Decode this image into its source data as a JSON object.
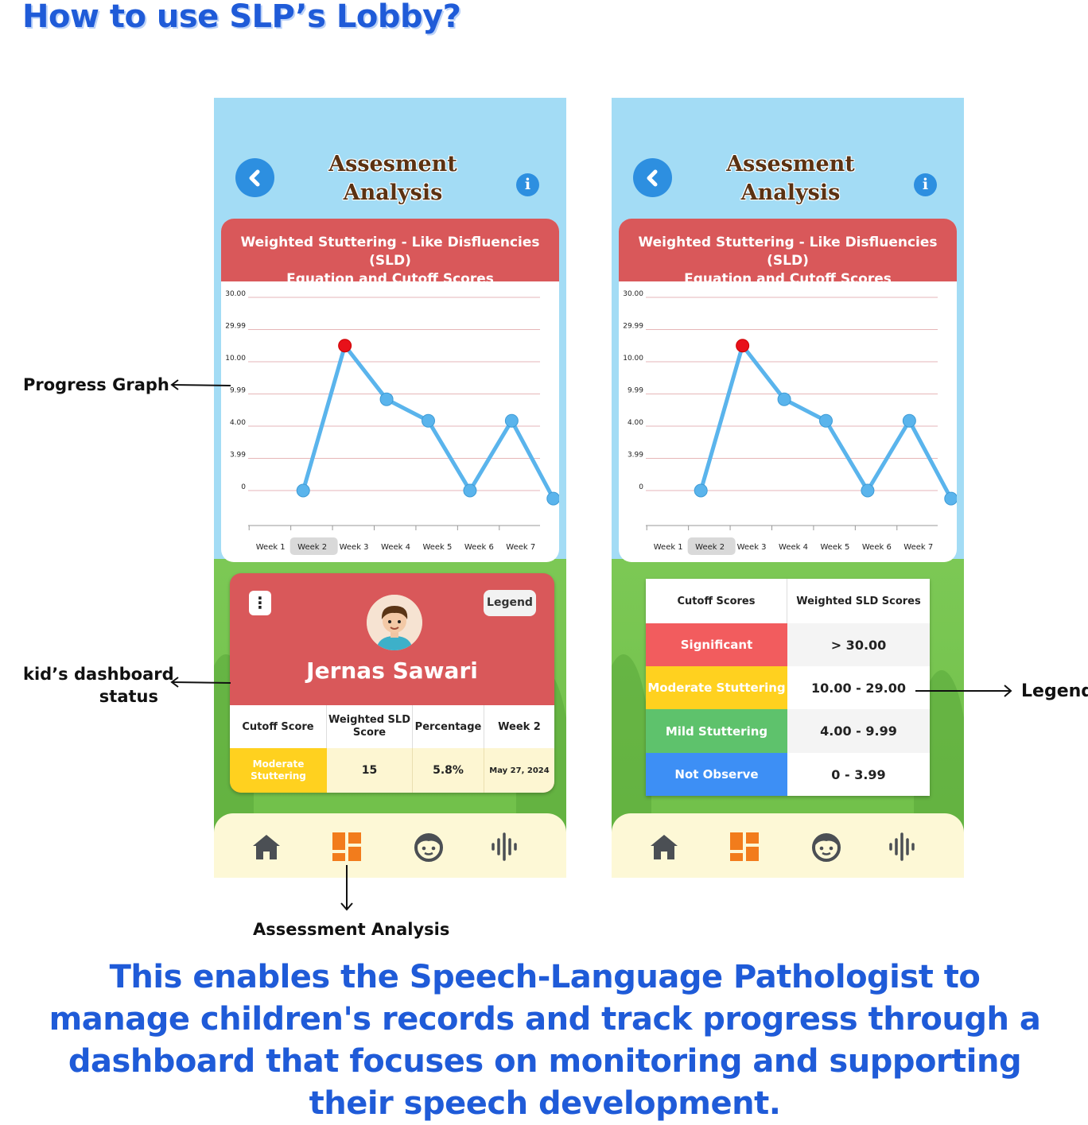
{
  "page_title": "How to use SLP’s Lobby?",
  "screen": {
    "title_line1": "Assesment",
    "title_line2": "Analysis",
    "back_icon": "chevron-left-icon",
    "info_icon": "info-icon",
    "info_glyph": "i"
  },
  "chart_card": {
    "header_line1": "Weighted Stuttering - Like Disfluencies (SLD)",
    "header_line2": "Equation and Cutoff Scores"
  },
  "chart_data": {
    "type": "line",
    "y_tick_labels": [
      "30.00",
      "29.99",
      "10.00",
      "9.99",
      "4.00",
      "3.99",
      "0"
    ],
    "categories": [
      "Week 1",
      "Week 2",
      "Week 3",
      "Week 4",
      "Week 5",
      "Week 6",
      "Week 7"
    ],
    "highlighted_category": "Week 2",
    "series": [
      {
        "values": [
          0,
          20,
          9,
          5,
          0,
          5,
          -1
        ]
      }
    ],
    "highlighted_point_index": 1,
    "colors": {
      "line": "#5ab4ec",
      "point": "#5ab4ec",
      "highlight_point": "#e8111a",
      "grid": "#e6b6b8"
    },
    "grid": true
  },
  "kid_card": {
    "menu_glyph": "⋮",
    "legend_button": "Legend",
    "avatar_icon": "kid-avatar-icon",
    "name": "Jernas Sawari",
    "headers": [
      "Cutoff Score",
      "Weighted SLD Score",
      "Percentage",
      "Week 2"
    ],
    "row": {
      "cutoff": "Moderate Stuttering",
      "score": "15",
      "percentage": "5.8%",
      "date": "May 27, 2024"
    }
  },
  "legend_table": {
    "headers": [
      "Cutoff Scores",
      "Weighted SLD Scores"
    ],
    "rows": [
      {
        "label": "Significant",
        "range": "> 30.00",
        "color": "#f25c5e"
      },
      {
        "label": "Moderate Stuttering",
        "range": "10.00 - 29.00",
        "color": "#ffd11f"
      },
      {
        "label": "Mild Stuttering",
        "range": "4.00 - 9.99",
        "color": "#5ec26c"
      },
      {
        "label": "Not Observe",
        "range": "0 - 3.99",
        "color": "#3d8ff5"
      }
    ]
  },
  "nav": {
    "items": [
      "home-icon",
      "dashboard-icon",
      "kid-face-icon",
      "audio-wave-icon"
    ],
    "active_color": "#f27c1c",
    "inactive_color": "#4b4f54"
  },
  "annotations": {
    "progress_graph": "Progress Graph",
    "kid_status_line1": "kid’s dashboard",
    "kid_status_line2": "status",
    "assessment_analysis": "Assessment Analysis",
    "legend": "Legend"
  },
  "footer_text": "This enables the Speech-Language Pathologist to manage children's records and track progress through a dashboard that focuses on monitoring and supporting their speech development."
}
